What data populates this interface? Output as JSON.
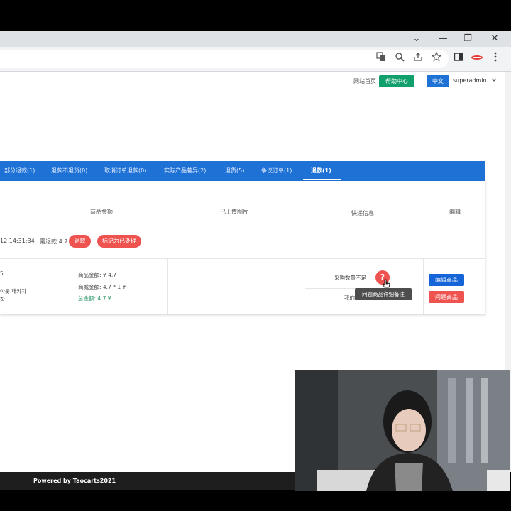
{
  "browser": {
    "controls": {
      "minimize": "—",
      "maximize": "❐",
      "close": "✕",
      "menu_chevron": "⌄"
    },
    "toolbar_icons": [
      "translate-icon",
      "zoom-icon",
      "share-icon",
      "bookmark-star-icon",
      "sidebar-icon",
      "extension-icon",
      "menu-icon"
    ]
  },
  "header": {
    "home_link": "网站首页",
    "help_button": "帮助中心",
    "lang_button": "中文",
    "user": "superadmin"
  },
  "tabs": [
    {
      "label": "部分退款(1)"
    },
    {
      "label": "退款不退货(0)"
    },
    {
      "label": "取消订单退款(0)"
    },
    {
      "label": "实际产品差异(2)"
    },
    {
      "label": "退货(5)"
    },
    {
      "label": "争议订单(1)"
    },
    {
      "label": "退款(1)",
      "active": true
    }
  ],
  "table": {
    "headers": {
      "amount": "商品金额",
      "images": "已上传图片",
      "shipping": "快递信息",
      "edit": "编辑"
    },
    "order": {
      "time": "12 14:31:34",
      "refund_amount": "需退款:4.7",
      "refund_pill": "退款",
      "mark_pill": "标记为已处理"
    },
    "item": {
      "left_fragment_1": "5",
      "left_fragment_2": "아웃 패키지",
      "left_fragment_3": "학",
      "goods_amount": "商品金额: ¥ 4.7",
      "mall_amount": "商城金额: 4.7 * 1 ¥",
      "total_amount": "总金额: 4.7 ¥",
      "reason": "采购数量不足",
      "note_prefix": "我的",
      "tooltip": "问题商品详细备注",
      "help_icon": "?",
      "edit_button": "编辑商品",
      "problem_button": "问题商品"
    }
  },
  "footer": {
    "text": "Powered by Taocarts2021"
  },
  "colors": {
    "tabbar": "#1e72d6",
    "help": "#11a06b",
    "lang": "#1e72d6",
    "pill_red": "#ef5350",
    "edit_btn": "#1565d8",
    "problem_btn": "#ef5350",
    "total_green": "#2e9a6a"
  }
}
